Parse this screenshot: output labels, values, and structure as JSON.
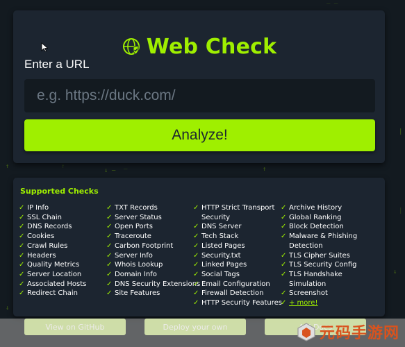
{
  "header": {
    "title": "Web Check",
    "icon": "globe-shield-icon"
  },
  "form": {
    "url_label": "Enter a URL",
    "url_placeholder": "e.g. https://duck.com/",
    "url_value": "",
    "analyze_label": "Analyze!"
  },
  "checks": {
    "title": "Supported Checks",
    "tick": "✓",
    "columns": [
      [
        "IP Info",
        "SSL Chain",
        "DNS Records",
        "Cookies",
        "Crawl Rules",
        "Headers",
        "Quality Metrics",
        "Server Location",
        "Associated Hosts",
        "Redirect Chain"
      ],
      [
        "TXT Records",
        "Server Status",
        "Open Ports",
        "Traceroute",
        "Carbon Footprint",
        "Server Info",
        "Whois Lookup",
        "Domain Info",
        "DNS Security Extensions",
        "Site Features"
      ],
      [
        "HTTP Strict Transport Security",
        "DNS Server",
        "Tech Stack",
        "Listed Pages",
        "Security.txt",
        "Linked Pages",
        "Social Tags",
        "Email Configuration",
        "Firewall Detection",
        "HTTP Security Features"
      ],
      [
        "Archive History",
        "Global Ranking",
        "Block Detection",
        "Malware & Phishing Detection",
        "TLS Cipher Suites",
        "TLS Security Config",
        "TLS Handshake Simulation",
        "Screenshot"
      ]
    ],
    "more_label": "+ more!"
  },
  "footer_buttons": {
    "github": "View on GitHub",
    "deploy": "Deploy your own",
    "api": "API Docs"
  },
  "watermark": {
    "text": "元码手游网"
  },
  "colors": {
    "accent": "#9fef00",
    "background": "#131a20",
    "card": "#1c2530",
    "watermark": "#d9531e"
  }
}
